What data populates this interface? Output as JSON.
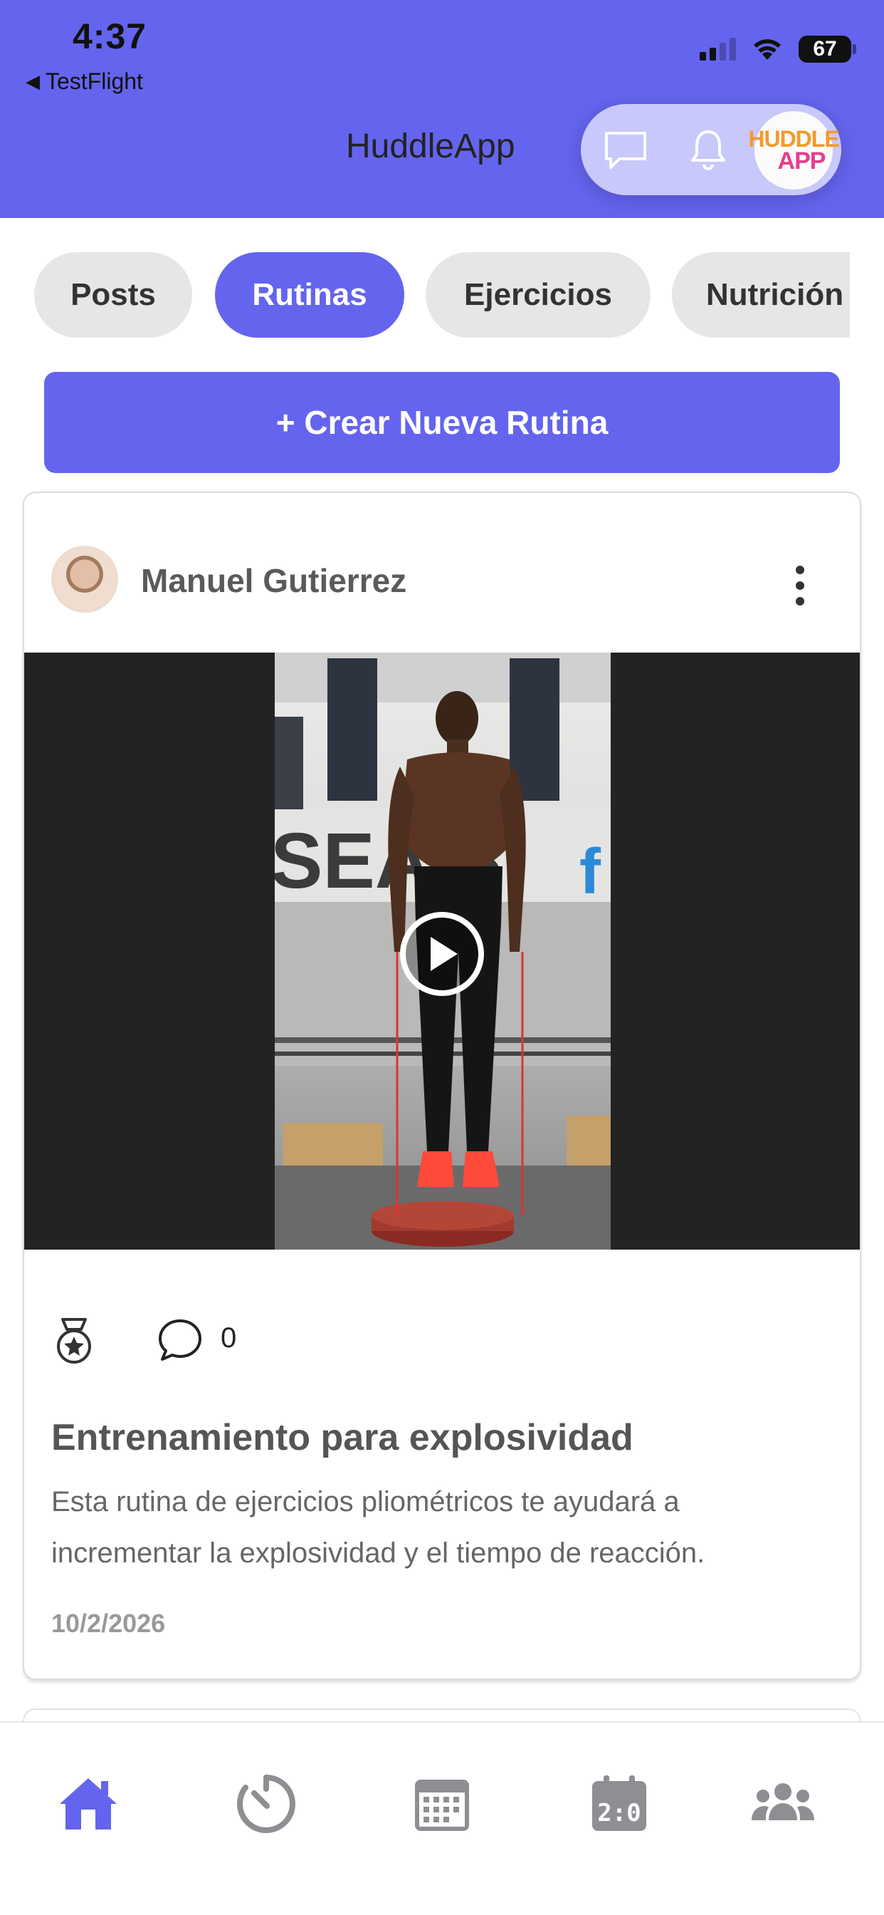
{
  "status_bar": {
    "time": "4:37",
    "back_app": "TestFlight",
    "battery": "67"
  },
  "header": {
    "title": "HuddleApp",
    "logo_line1": "HUDDLE",
    "logo_line2": "APP",
    "icons": [
      "chat-icon",
      "bell-icon"
    ]
  },
  "tabs": [
    {
      "label": "Posts",
      "active": false
    },
    {
      "label": "Rutinas",
      "active": true
    },
    {
      "label": "Ejercicios",
      "active": false
    },
    {
      "label": "Nutrición",
      "active": false
    }
  ],
  "create_button": "+ Crear Nueva Rutina",
  "post": {
    "author": "Manuel Gutierrez",
    "comment_count": "0",
    "title": "Entrenamiento para explosividad",
    "description": "Esta rutina de ejercicios pliométricos te ayudará a incrementar la explosividad y el tiempo de reacción.",
    "date": "10/2/2026",
    "video_background_text": "SEA    S"
  },
  "bottom_nav": [
    {
      "icon": "home-icon",
      "active": true
    },
    {
      "icon": "timer-icon",
      "active": false
    },
    {
      "icon": "calendar-icon",
      "active": false
    },
    {
      "icon": "scoreboard-icon",
      "active": false
    },
    {
      "icon": "community-icon",
      "active": false
    }
  ],
  "colors": {
    "brand": "#6464ee",
    "tab_inactive": "#e6e6e6",
    "nav_active": "#6464ee",
    "nav_inactive": "#8e8e93"
  }
}
